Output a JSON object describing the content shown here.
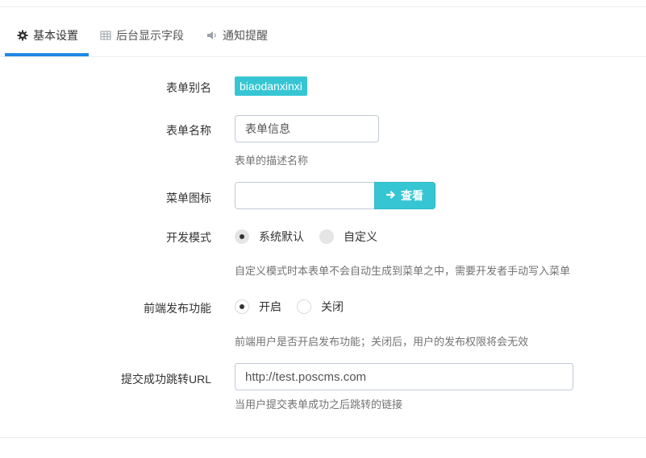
{
  "tabs": [
    {
      "label": "基本设置",
      "icon": "gear-icon",
      "active": true
    },
    {
      "label": "后台显示字段",
      "icon": "table-icon",
      "active": false
    },
    {
      "label": "通知提醒",
      "icon": "volume-icon",
      "active": false
    }
  ],
  "form": {
    "alias": {
      "label": "表单别名",
      "value": "biaodanxinxi"
    },
    "name": {
      "label": "表单名称",
      "value": "表单信息",
      "help": "表单的描述名称"
    },
    "menu_icon": {
      "label": "菜单图标",
      "value": "",
      "button": "查看"
    },
    "dev_mode": {
      "label": "开发模式",
      "options": [
        "系统默认",
        "自定义"
      ],
      "selected": "系统默认",
      "help": "自定义模式时本表单不会自动生成到菜单之中，需要开发者手动写入菜单"
    },
    "frontend_publish": {
      "label": "前端发布功能",
      "options": [
        "开启",
        "关闭"
      ],
      "selected": "开启",
      "help": "前端用户是否开启发布功能；关闭后，用户的发布权限将会无效"
    },
    "redirect_url": {
      "label": "提交成功跳转URL",
      "value": "http://test.poscms.com",
      "help": "当用户提交表单成功之后跳转的链接"
    }
  },
  "colors": {
    "accent": "#36c6d3",
    "tab_active": "#1e88e5"
  }
}
